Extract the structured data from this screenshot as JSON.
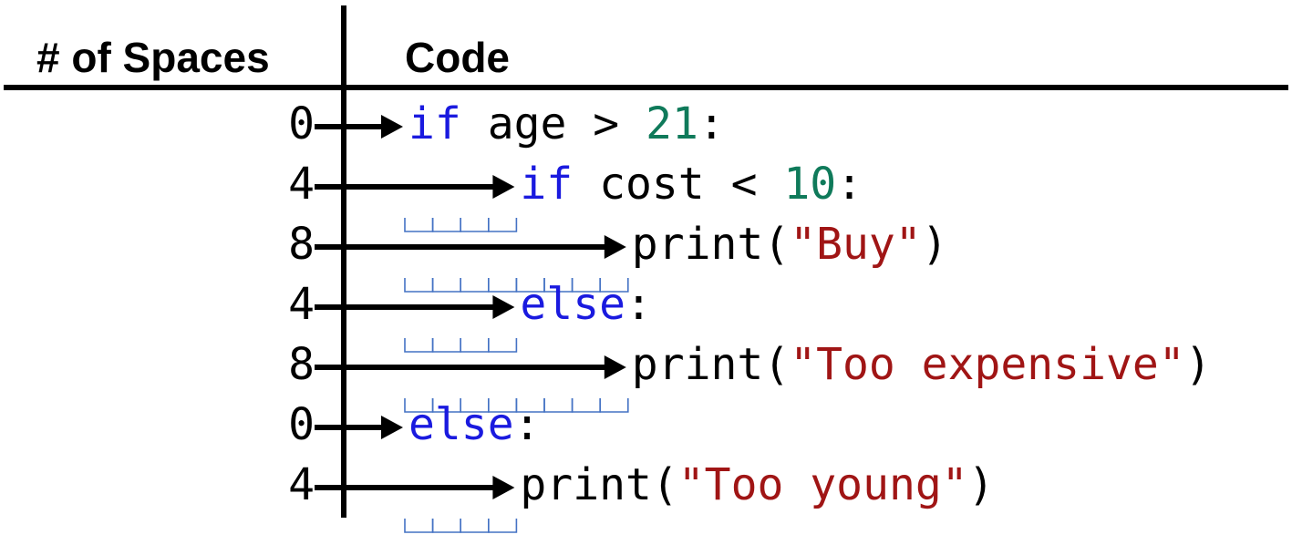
{
  "headers": {
    "spaces": "# of Spaces",
    "code": "Code"
  },
  "colors": {
    "keyword": "#1a1adf",
    "number": "#0f7a5a",
    "string": "#a01515",
    "plain": "#000000",
    "space_marker": "#4472c4"
  },
  "lines": [
    {
      "spaces": 0,
      "count_label": "0",
      "tokens": [
        {
          "text": "if",
          "kind": "keyword"
        },
        {
          "text": " age > ",
          "kind": "plain"
        },
        {
          "text": "21",
          "kind": "number"
        },
        {
          "text": ":",
          "kind": "plain"
        }
      ]
    },
    {
      "spaces": 4,
      "count_label": "4",
      "tokens": [
        {
          "text": "if",
          "kind": "keyword"
        },
        {
          "text": " cost < ",
          "kind": "plain"
        },
        {
          "text": "10",
          "kind": "number"
        },
        {
          "text": ":",
          "kind": "plain"
        }
      ]
    },
    {
      "spaces": 8,
      "count_label": "8",
      "tokens": [
        {
          "text": "print(",
          "kind": "plain"
        },
        {
          "text": "\"Buy\"",
          "kind": "string"
        },
        {
          "text": ")",
          "kind": "plain"
        }
      ]
    },
    {
      "spaces": 4,
      "count_label": "4",
      "tokens": [
        {
          "text": "else",
          "kind": "keyword"
        },
        {
          "text": ":",
          "kind": "plain"
        }
      ]
    },
    {
      "spaces": 8,
      "count_label": "8",
      "tokens": [
        {
          "text": "print(",
          "kind": "plain"
        },
        {
          "text": "\"Too expensive\"",
          "kind": "string"
        },
        {
          "text": ")",
          "kind": "plain"
        }
      ]
    },
    {
      "spaces": 0,
      "count_label": "0",
      "tokens": [
        {
          "text": "else",
          "kind": "keyword"
        },
        {
          "text": ":",
          "kind": "plain"
        }
      ]
    },
    {
      "spaces": 4,
      "count_label": "4",
      "tokens": [
        {
          "text": "print(",
          "kind": "plain"
        },
        {
          "text": "\"Too young\"",
          "kind": "string"
        },
        {
          "text": ")",
          "kind": "plain"
        }
      ]
    }
  ]
}
